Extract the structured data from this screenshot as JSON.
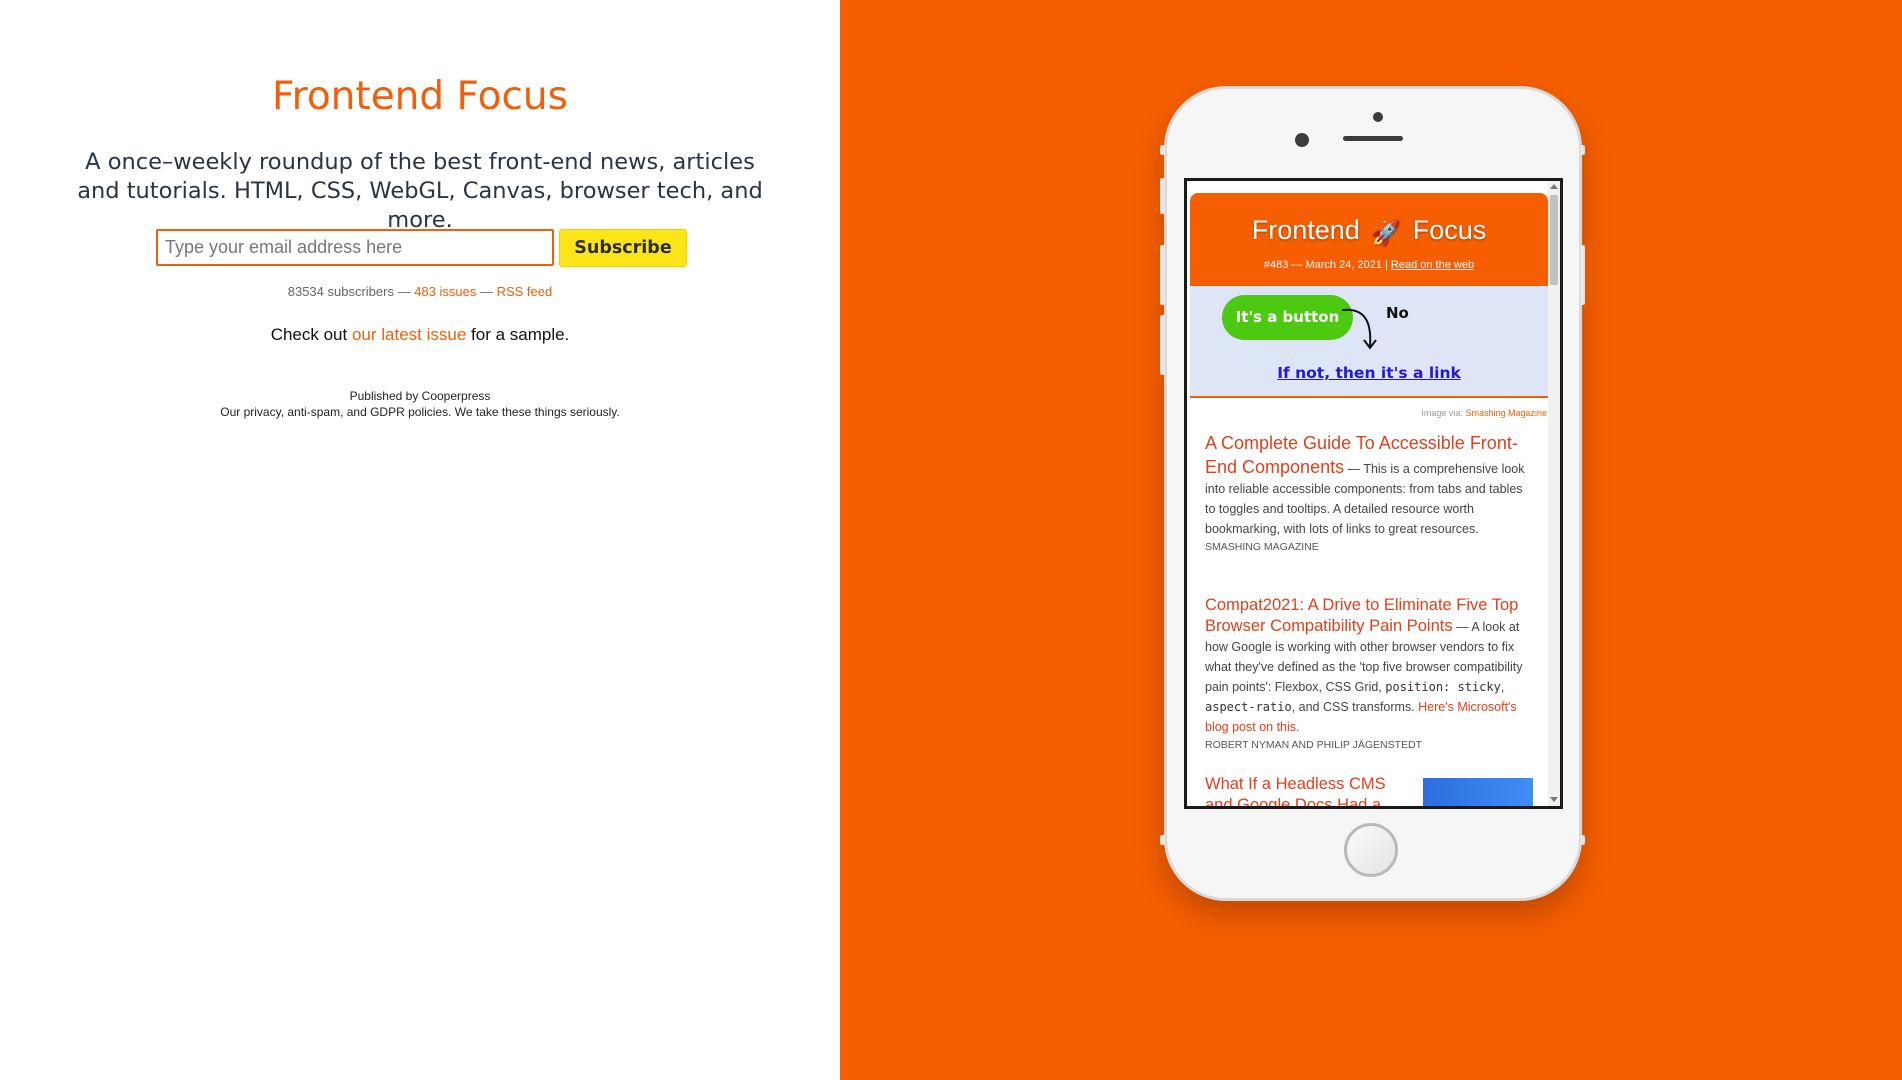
{
  "left": {
    "title": "Frontend Focus",
    "tagline": "A once–weekly roundup of the best front-end news, articles and tutorials. HTML, CSS, WebGL, Canvas, browser tech, and more.",
    "form": {
      "email_placeholder": "Type your email address here",
      "subscribe_label": "Subscribe"
    },
    "stats": {
      "subscribers": "83534 subscribers",
      "sep1": " — ",
      "issues_link": "483 issues",
      "sep2": " — ",
      "rss_link": "RSS feed"
    },
    "sample": {
      "prefix": "Check out ",
      "link": "our latest issue",
      "suffix": " for a sample."
    },
    "publisher": {
      "line1": "Published by Cooperpress",
      "line2": "Our privacy, anti-spam, and GDPR policies. We take these things seriously."
    }
  },
  "phone": {
    "newsletter": {
      "title_left": "Frontend",
      "title_icon": "rocket-icon",
      "title_right": "Focus",
      "meta": "#483 — March 24, 2021 | ",
      "web_link": "Read on the web"
    },
    "hero": {
      "button_text": "It's a button",
      "no_text": "No",
      "link_text": "If not, then it's a link"
    },
    "credit": {
      "prefix": "Image via: ",
      "source": "Smashing Magazine"
    },
    "articles": [
      {
        "title": "A Complete Guide To Accessible Front-End Components",
        "body": " — This is a comprehensive look into reliable accessible components: from tabs and tables to toggles and tooltips. A detailed resource worth bookmarking, with lots of links to great resources.",
        "source": "SMASHING MAGAZINE"
      },
      {
        "title": "Compat2021: A Drive to Eliminate Five Top Browser Compatibility Pain Points",
        "body_1": " — A look at how Google is working with other browser vendors to fix what they've defined as the 'top five browser compatibility pain points': Flexbox, CSS Grid, ",
        "code_1": "position: sticky",
        "body_2": ", ",
        "code_2": "aspect-ratio",
        "body_3": ", and CSS transforms. ",
        "link": "Here's Microsoft's blog post on this.",
        "source": "ROBERT NYMAN AND PHILIP JÄGENSTEDT"
      },
      {
        "title": "What If a Headless CMS and Google Docs Had a"
      }
    ]
  },
  "colors": {
    "brand_orange": "#f65e01",
    "title_orange": "#f25f0a",
    "button_yellow": "#fde51a",
    "hero_green": "#4dc911",
    "hero_link_blue": "#2318d8"
  }
}
